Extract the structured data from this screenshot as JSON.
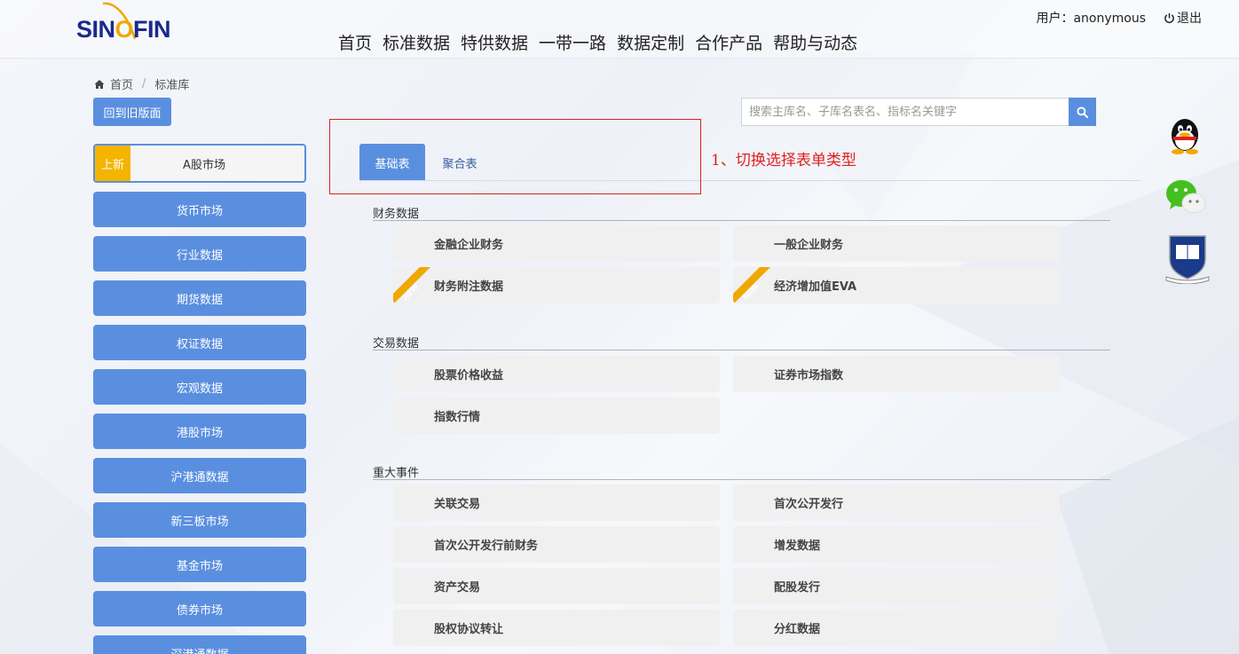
{
  "header": {
    "logo": {
      "pre": "SIN",
      "mid": "O",
      "post": "FIN"
    },
    "nav": [
      "首页",
      "标准数据",
      "特供数据",
      "一带一路",
      "数据定制",
      "合作产品",
      "帮助与动态"
    ],
    "user_label": "用户：anonymous",
    "logout_label": "退出"
  },
  "breadcrumb": {
    "home": "首页",
    "current": "标准库"
  },
  "old_version_button": "回到旧版面",
  "sidebar": {
    "active": {
      "badge": "上新",
      "label": "A股市场"
    },
    "items": [
      "货币市场",
      "行业数据",
      "期货数据",
      "权证数据",
      "宏观数据",
      "港股市场",
      "沪港通数据",
      "新三板市场",
      "基金市场",
      "债券市场",
      "深港通数据"
    ]
  },
  "search": {
    "placeholder": "搜索主库名、子库名表名、指标名关键字"
  },
  "tabs": {
    "basic": "基础表",
    "aggregate": "聚合表"
  },
  "annotation": "1、切换选择表单类型",
  "sections": [
    {
      "title": "财务数据",
      "cards": [
        {
          "label": "金融企业财务",
          "new": false
        },
        {
          "label": "一般企业财务",
          "new": false
        },
        {
          "label": "财务附注数据",
          "new": true
        },
        {
          "label": "经济增加值EVA",
          "new": true
        }
      ]
    },
    {
      "title": "交易数据",
      "cards": [
        {
          "label": "股票价格收益",
          "new": false
        },
        {
          "label": "证券市场指数",
          "new": false
        },
        {
          "label": "指数行情",
          "new": false
        }
      ]
    },
    {
      "title": "重大事件",
      "cards": [
        {
          "label": "关联交易",
          "new": false
        },
        {
          "label": "首次公开发行",
          "new": false
        },
        {
          "label": "首次公开发行前财务",
          "new": false
        },
        {
          "label": "增发数据",
          "new": false
        },
        {
          "label": "资产交易",
          "new": false
        },
        {
          "label": "配股发行",
          "new": false
        },
        {
          "label": "股权协议转让",
          "new": false
        },
        {
          "label": "分红数据",
          "new": false
        }
      ]
    }
  ],
  "ribbon_text": "NEW",
  "float_icons": [
    "qq-icon",
    "wechat-icon",
    "university-crest-icon"
  ],
  "colors": {
    "primary": "#5a8fe0",
    "badge": "#f4b400",
    "annotation": "#e02020",
    "logo_blue": "#1a2a8a",
    "logo_gold": "#f0a800"
  }
}
